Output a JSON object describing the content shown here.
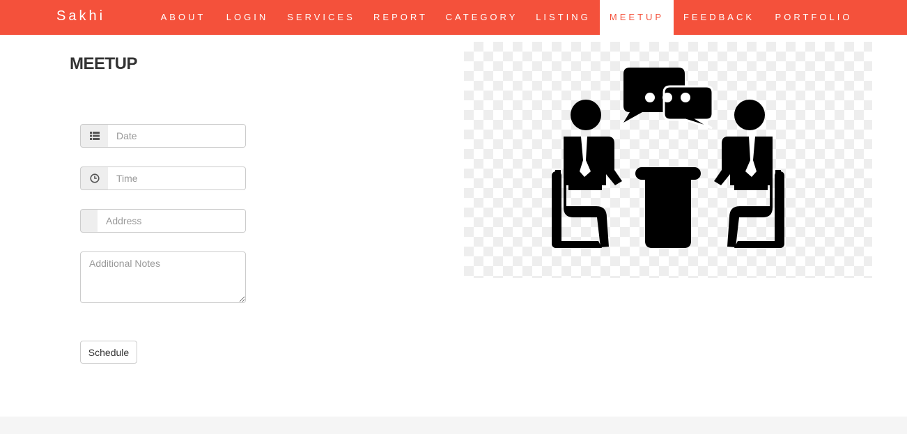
{
  "navbar": {
    "brand": "Sakhi",
    "items": [
      {
        "label": "ABOUT"
      },
      {
        "label": "LOGIN"
      },
      {
        "label": "SERVICES"
      },
      {
        "label": "REPORT"
      },
      {
        "label": "CATEGORY"
      },
      {
        "label": "LISTING"
      },
      {
        "label": "MEETUP",
        "active": true
      },
      {
        "label": "FEEDBACK"
      },
      {
        "label": "PORTFOLIO"
      }
    ]
  },
  "page": {
    "title": "MEETUP"
  },
  "form": {
    "date_placeholder": "Date",
    "time_placeholder": "Time",
    "address_placeholder": "Address",
    "notes_placeholder": "Additional Notes",
    "submit_label": "Schedule"
  },
  "colors": {
    "nav_background": "#f4513b",
    "nav_text": "#ffffff",
    "active_text": "#f4513b"
  },
  "icons": {
    "date": "list-icon",
    "time": "clock-icon",
    "image": "business-meeting-icon"
  }
}
